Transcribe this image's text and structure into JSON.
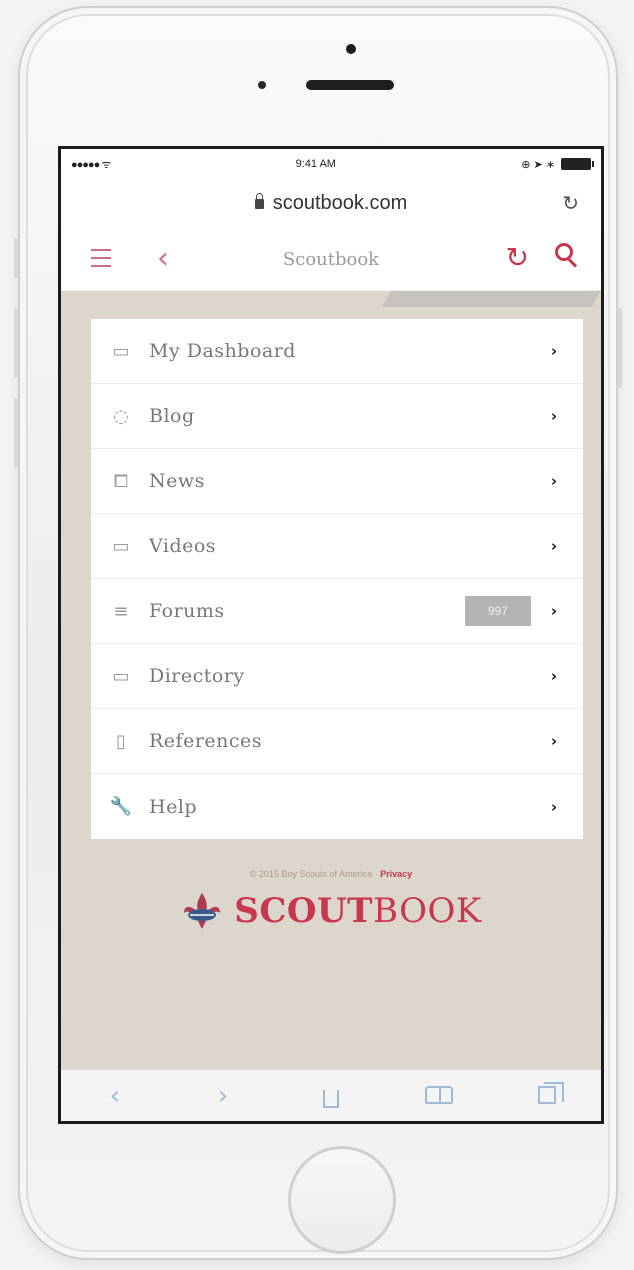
{
  "status_bar": {
    "signal": "●●●●● ᯤ",
    "time": "9:41 AM",
    "right_icons": "⊕ ➤ ∗"
  },
  "browser": {
    "url": "scoutbook.com",
    "reload_glyph": "↻"
  },
  "app_header": {
    "back_glyph": "‹",
    "title": "Scoutbook",
    "refresh_glyph": "↻"
  },
  "menu": {
    "items": [
      {
        "label": "My Dashboard",
        "icon": "calendar-icon",
        "glyph": "▭"
      },
      {
        "label": "Blog",
        "icon": "chat-bubble-icon",
        "glyph": "◌"
      },
      {
        "label": "News",
        "icon": "open-book-icon",
        "glyph": "⧠"
      },
      {
        "label": "Videos",
        "icon": "video-camera-icon",
        "glyph": "▭"
      },
      {
        "label": "Forums",
        "icon": "list-lines-icon",
        "glyph": "≡",
        "badge": "997"
      },
      {
        "label": "Directory",
        "icon": "folder-icon",
        "glyph": "▭"
      },
      {
        "label": "References",
        "icon": "document-icon",
        "glyph": "▯"
      },
      {
        "label": "Help",
        "icon": "wrench-icon",
        "glyph": "🔧"
      }
    ],
    "chevron_glyph": "›"
  },
  "footer": {
    "copyright": "© 2015 Boy Scouts of America ·",
    "privacy_link": "Privacy",
    "logo_bold": "SCOUT",
    "logo_light": "BOOK"
  },
  "browser_toolbar": {
    "back_glyph": "‹",
    "forward_glyph": "›"
  },
  "colors": {
    "brand_red": "#c8374f",
    "menu_background": "#ddd6cc",
    "toolbar_icon": "#9fb9d6"
  }
}
